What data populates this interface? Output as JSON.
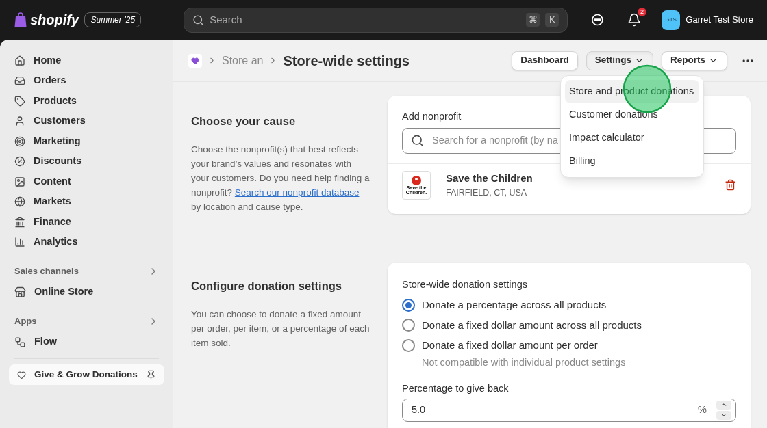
{
  "topbar": {
    "brand": "shopify",
    "edition": "Summer ’25",
    "search": {
      "placeholder": "Search",
      "keys": [
        "⌘",
        "K"
      ]
    },
    "notifications": "2",
    "store": {
      "initials": "GTS",
      "name": "Garret Test Store"
    }
  },
  "sidebar": {
    "items": [
      {
        "label": "Home",
        "selected": false
      },
      {
        "label": "Orders",
        "selected": false
      },
      {
        "label": "Products",
        "selected": false
      },
      {
        "label": "Customers",
        "selected": false
      },
      {
        "label": "Marketing",
        "selected": false
      },
      {
        "label": "Discounts",
        "selected": false
      },
      {
        "label": "Content",
        "selected": false
      },
      {
        "label": "Markets",
        "selected": false
      },
      {
        "label": "Finance",
        "selected": false
      },
      {
        "label": "Analytics",
        "selected": false
      }
    ],
    "sections": [
      {
        "title": "Sales channels",
        "items": [
          {
            "label": "Online Store"
          }
        ]
      },
      {
        "title": "Apps",
        "items": [
          {
            "label": "Flow"
          }
        ]
      }
    ],
    "pinned": {
      "label": "Give & Grow Donations",
      "selected": true
    }
  },
  "header": {
    "breadcrumb": "Store an",
    "title": "Store-wide settings",
    "buttons": [
      {
        "label": "Dashboard",
        "kind": "plain",
        "expanded": false
      },
      {
        "label": "Settings",
        "kind": "menu",
        "expanded": true
      },
      {
        "label": "Reports",
        "kind": "menu",
        "expanded": false
      }
    ],
    "menu": [
      {
        "label": "Store and product donations",
        "selected": true
      },
      {
        "label": "Customer donations",
        "selected": false
      },
      {
        "label": "Impact calculator",
        "selected": false
      },
      {
        "label": "Billing",
        "selected": false
      }
    ]
  },
  "cause": {
    "title": "Choose your cause",
    "text_before": "Choose the nonprofit(s) that best reflects your brand’s values and resonates with your customers. Do you need help finding a nonprofit?",
    "link": "Search our nonprofit database",
    "text_after": "by location and cause type.",
    "field_label": "Add nonprofit",
    "placeholder": "Search for a nonprofit (by na",
    "nonprofit": {
      "logo_text": [
        "Save the",
        "Children."
      ],
      "name": "Save the Children",
      "location": "FAIRFIELD, CT, USA"
    }
  },
  "donation": {
    "title": "Configure donation settings",
    "text": "You can choose to donate a fixed amount per order, per item, or a percentage of each item sold.",
    "group_label": "Store-wide donation settings",
    "options": [
      {
        "label": "Donate a percentage across all products",
        "selected": true
      },
      {
        "label": "Donate a fixed dollar amount across all products",
        "selected": false
      },
      {
        "label": "Donate a fixed dollar amount per order",
        "selected": false,
        "help": "Not compatible with individual product settings"
      }
    ],
    "percent_label": "Percentage to give back",
    "percent_value": "5.0",
    "suffix": "%"
  }
}
